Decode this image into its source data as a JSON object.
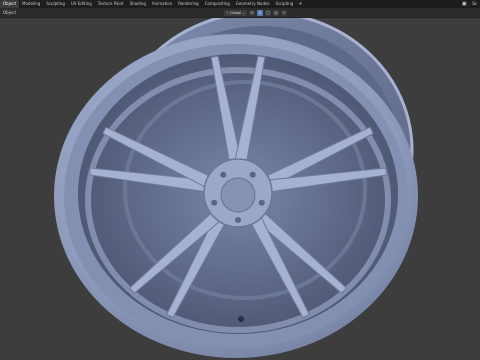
{
  "workspace_tabs": [
    {
      "label": "Object",
      "active": true
    },
    {
      "label": "Modeling",
      "active": false
    },
    {
      "label": "Sculpting",
      "active": false
    },
    {
      "label": "UV Editing",
      "active": false
    },
    {
      "label": "Texture Paint",
      "active": false
    },
    {
      "label": "Shading",
      "active": false
    },
    {
      "label": "Animation",
      "active": false
    },
    {
      "label": "Rendering",
      "active": false
    },
    {
      "label": "Compositing",
      "active": false
    },
    {
      "label": "Geometry Nodes",
      "active": false
    },
    {
      "label": "Scripting",
      "active": false
    }
  ],
  "add_tab": "+",
  "toolbar": {
    "mode": "Object",
    "transform_orientation": "Global",
    "dropdown_arrow": "⌄",
    "right_label": "Sc"
  },
  "icons": {
    "pivot": "pivot-icon",
    "snap": "magnet-icon",
    "proportional": "proportional-edit-icon"
  },
  "viewport": {
    "background": "#3d3d3d",
    "model": "alloy-wheel",
    "model_color": "#9aa7c8",
    "spoke_count": 10
  }
}
